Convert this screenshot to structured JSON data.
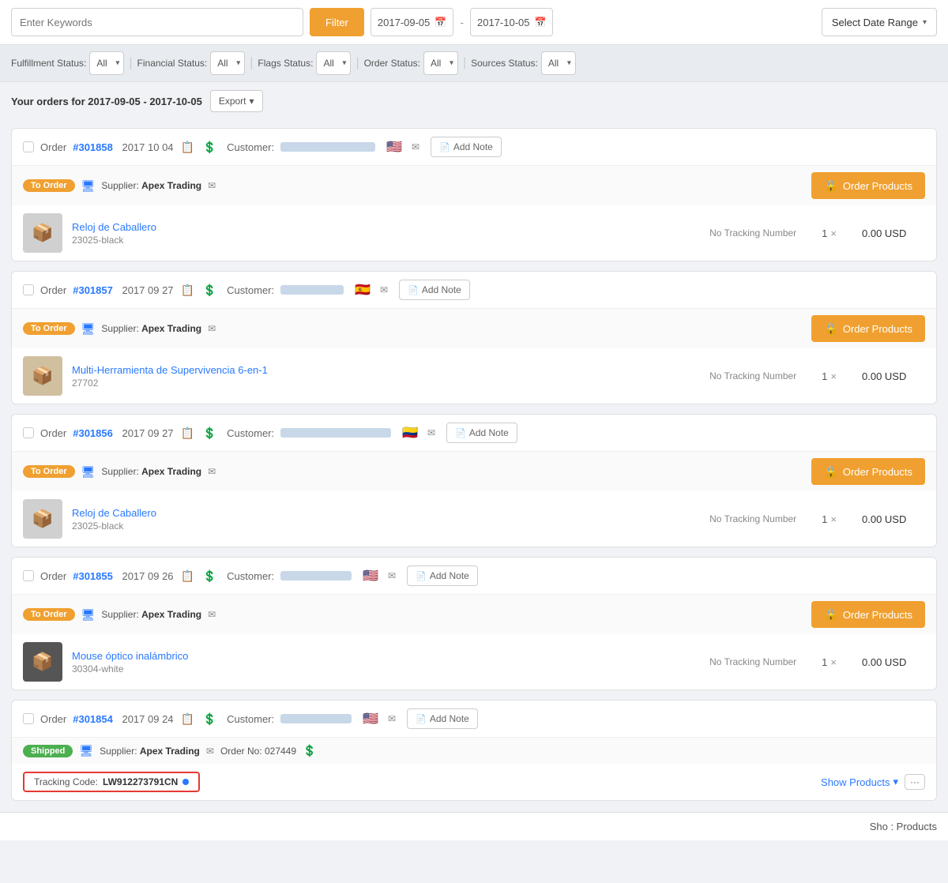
{
  "topbar": {
    "search_placeholder": "Enter Keywords",
    "filter_label": "Filter",
    "date_from": "2017-09-05",
    "date_to": "2017-10-05",
    "date_range_label": "Select Date Range"
  },
  "filters": {
    "fulfillment": {
      "label": "Fulfillment Status:",
      "value": "All"
    },
    "financial": {
      "label": "Financial Status:",
      "value": "All"
    },
    "flags": {
      "label": "Flags Status:",
      "value": "All"
    },
    "order": {
      "label": "Order Status:",
      "value": "All"
    },
    "sources": {
      "label": "Sources Status:",
      "value": "All"
    }
  },
  "orders_header": {
    "title": "Your orders for 2017-09-05 - 2017-10-05",
    "export_label": "Export"
  },
  "orders": [
    {
      "id": "order-301858",
      "number": "#301858",
      "date": "2017 10 04",
      "icons": [
        "note",
        "dollar"
      ],
      "customer_label": "Customer:",
      "customer_name_width": 120,
      "flag": "🇺🇸",
      "add_note": "Add Note",
      "supplier_badge": "To Order",
      "supplier_badge_type": "to-order",
      "supplier_icon": "monitor",
      "supplier": "Apex Trading",
      "order_products_label": "Order Products",
      "products": [
        {
          "name": "Reloj de Caballero",
          "sku": "23025-black",
          "tracking": "No Tracking Number",
          "qty": "1",
          "price": "0.00 USD",
          "thumb_color": "#d0d0d0"
        }
      ]
    },
    {
      "id": "order-301857",
      "number": "#301857",
      "date": "2017 09 27",
      "icons": [
        "note",
        "dollar"
      ],
      "customer_label": "Customer:",
      "customer_name_width": 80,
      "flag": "🇪🇸",
      "add_note": "Add Note",
      "supplier_badge": "To Order",
      "supplier_badge_type": "to-order",
      "supplier_icon": "monitor",
      "supplier": "Apex Trading",
      "order_products_label": "Order Products",
      "products": [
        {
          "name": "Multi-Herramienta de Supervivencia 6-en-1",
          "sku": "27702",
          "tracking": "No Tracking Number",
          "qty": "1",
          "price": "0.00 USD",
          "thumb_color": "#d0c0a0"
        }
      ]
    },
    {
      "id": "order-301856",
      "number": "#301856",
      "date": "2017 09 27",
      "icons": [
        "note",
        "dollar"
      ],
      "customer_label": "Customer:",
      "customer_name_width": 140,
      "flag": "🇨🇴",
      "add_note": "Add Note",
      "supplier_badge": "To Order",
      "supplier_badge_type": "to-order",
      "supplier_icon": "monitor",
      "supplier": "Apex Trading",
      "order_products_label": "Order Products",
      "products": [
        {
          "name": "Reloj de Caballero",
          "sku": "23025-black",
          "tracking": "No Tracking Number",
          "qty": "1",
          "price": "0.00 USD",
          "thumb_color": "#d0d0d0"
        }
      ]
    },
    {
      "id": "order-301855",
      "number": "#301855",
      "date": "2017 09 26",
      "icons": [
        "note",
        "dollar"
      ],
      "customer_label": "Customer:",
      "customer_name_width": 90,
      "flag": "🇺🇸",
      "add_note": "Add Note",
      "supplier_badge": "To Order",
      "supplier_badge_type": "to-order",
      "supplier_icon": "monitor",
      "supplier": "Apex Trading",
      "order_products_label": "Order Products",
      "products": [
        {
          "name": "Mouse óptico inalámbrico",
          "sku": "30304-white",
          "tracking": "No Tracking Number",
          "qty": "1",
          "price": "0.00 USD",
          "thumb_color": "#555555"
        }
      ]
    },
    {
      "id": "order-301854",
      "number": "#301854",
      "date": "2017 09 24",
      "icons": [
        "envelope",
        "dollar"
      ],
      "customer_label": "Customer:",
      "customer_name_width": 90,
      "flag": "🇺🇸",
      "add_note": "Add Note",
      "supplier_badge": "Shipped",
      "supplier_badge_type": "shipped",
      "supplier_icon": "monitor",
      "supplier": "Apex Trading",
      "order_no_label": "Order No:",
      "order_no": "027449",
      "order_no_dollar": true,
      "tracking_code_label": "Tracking Code:",
      "tracking_code": "LW912273791CN",
      "show_products_label": "Show Products",
      "more_label": "···"
    }
  ],
  "bottom": {
    "sho_label": "Sho : Products"
  }
}
